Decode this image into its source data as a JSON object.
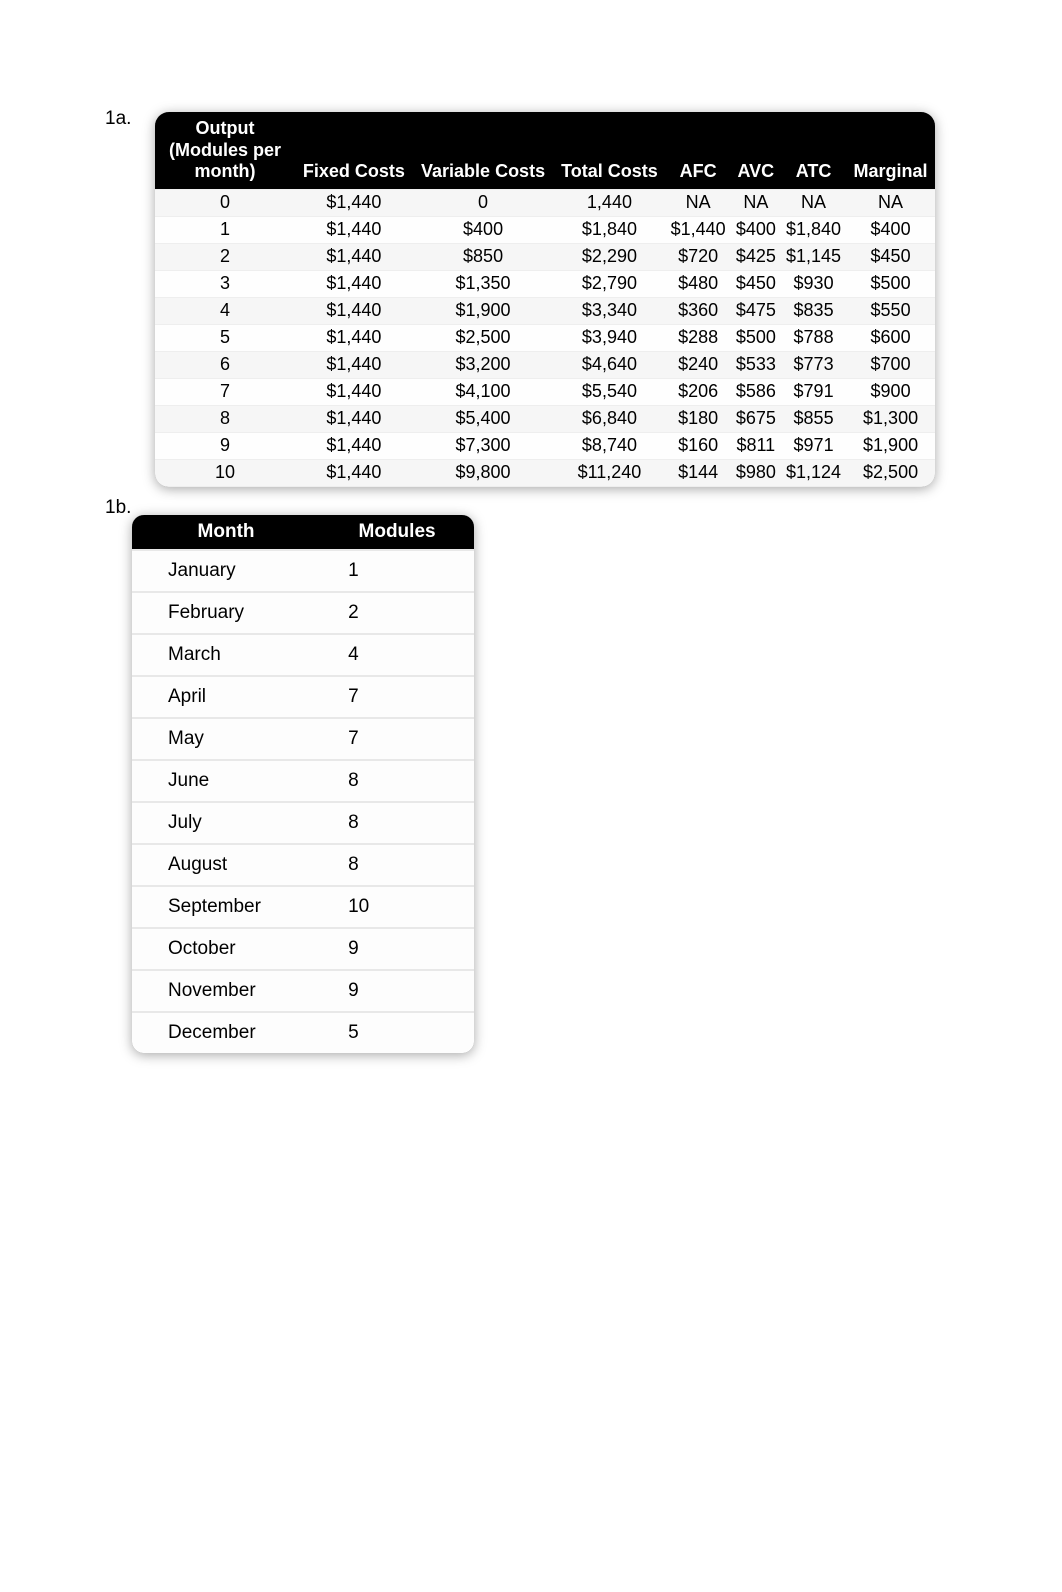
{
  "labels": {
    "section_1a": "1a.",
    "section_1b": "1b."
  },
  "tableA": {
    "headers": {
      "output": "Output (Modules per month)",
      "fixed": "Fixed Costs",
      "variable": "Variable Costs",
      "total": "Total Costs",
      "afc": "AFC",
      "avc": "AVC",
      "atc": "ATC",
      "marginal": "Marginal"
    },
    "rows": [
      {
        "output": "0",
        "fixed": "$1,440",
        "variable": "0",
        "total": "1,440",
        "afc": "NA",
        "avc": "NA",
        "atc": "NA",
        "marginal": "NA"
      },
      {
        "output": "1",
        "fixed": "$1,440",
        "variable": "$400",
        "total": "$1,840",
        "afc": "$1,440",
        "avc": "$400",
        "atc": "$1,840",
        "marginal": "$400"
      },
      {
        "output": "2",
        "fixed": "$1,440",
        "variable": "$850",
        "total": "$2,290",
        "afc": "$720",
        "avc": "$425",
        "atc": "$1,145",
        "marginal": "$450"
      },
      {
        "output": "3",
        "fixed": "$1,440",
        "variable": "$1,350",
        "total": "$2,790",
        "afc": "$480",
        "avc": "$450",
        "atc": "$930",
        "marginal": "$500"
      },
      {
        "output": "4",
        "fixed": "$1,440",
        "variable": "$1,900",
        "total": "$3,340",
        "afc": "$360",
        "avc": "$475",
        "atc": "$835",
        "marginal": "$550"
      },
      {
        "output": "5",
        "fixed": "$1,440",
        "variable": "$2,500",
        "total": "$3,940",
        "afc": "$288",
        "avc": "$500",
        "atc": "$788",
        "marginal": "$600"
      },
      {
        "output": "6",
        "fixed": "$1,440",
        "variable": "$3,200",
        "total": "$4,640",
        "afc": "$240",
        "avc": "$533",
        "atc": "$773",
        "marginal": "$700"
      },
      {
        "output": "7",
        "fixed": "$1,440",
        "variable": "$4,100",
        "total": "$5,540",
        "afc": "$206",
        "avc": "$586",
        "atc": "$791",
        "marginal": "$900"
      },
      {
        "output": "8",
        "fixed": "$1,440",
        "variable": "$5,400",
        "total": "$6,840",
        "afc": "$180",
        "avc": "$675",
        "atc": "$855",
        "marginal": "$1,300"
      },
      {
        "output": "9",
        "fixed": "$1,440",
        "variable": "$7,300",
        "total": "$8,740",
        "afc": "$160",
        "avc": "$811",
        "atc": "$971",
        "marginal": "$1,900"
      },
      {
        "output": "10",
        "fixed": "$1,440",
        "variable": "$9,800",
        "total": "$11,240",
        "afc": "$144",
        "avc": "$980",
        "atc": "$1,124",
        "marginal": "$2,500"
      }
    ]
  },
  "tableB": {
    "headers": {
      "month": "Month",
      "modules": "Modules"
    },
    "rows": [
      {
        "month": "January",
        "modules": "1"
      },
      {
        "month": "February",
        "modules": "2"
      },
      {
        "month": "March",
        "modules": "4"
      },
      {
        "month": "April",
        "modules": "7"
      },
      {
        "month": "May",
        "modules": "7"
      },
      {
        "month": "June",
        "modules": "8"
      },
      {
        "month": "July",
        "modules": "8"
      },
      {
        "month": "August",
        "modules": "8"
      },
      {
        "month": "September",
        "modules": "10"
      },
      {
        "month": "October",
        "modules": "9"
      },
      {
        "month": "November",
        "modules": "9"
      },
      {
        "month": "December",
        "modules": "5"
      }
    ]
  }
}
